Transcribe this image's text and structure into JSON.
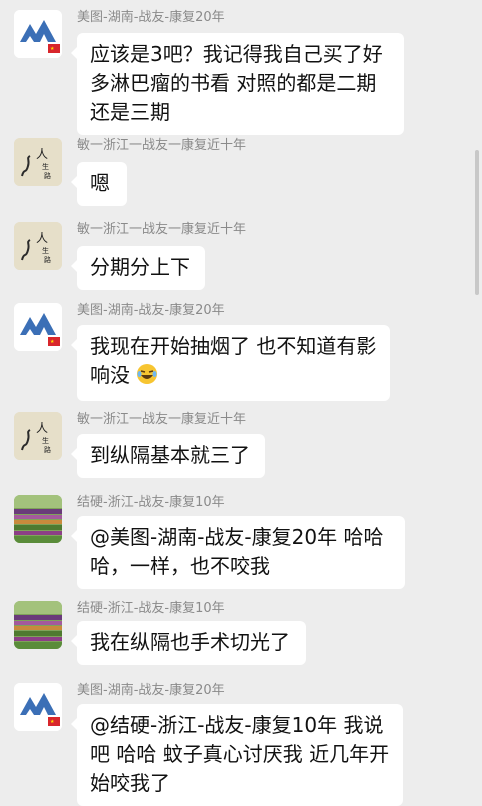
{
  "messages": [
    {
      "sender": "美图-湖南-战友-康复20年",
      "avatar": "mountain-flag-avatar",
      "lines": [
        "应该是3吧？我记得我自己买了好",
        "多淋巴瘤的书看 对照的都是二期",
        "还是三期"
      ]
    },
    {
      "sender": "敏一浙江一战友一康复近十年",
      "avatar": "calligraphy-avatar",
      "lines": [
        "嗯"
      ]
    },
    {
      "sender": "敏一浙江一战友一康复近十年",
      "avatar": "calligraphy-avatar",
      "lines": [
        "分期分上下"
      ]
    },
    {
      "sender": "美图-湖南-战友-康复20年",
      "avatar": "mountain-flag-avatar",
      "lines": [
        "我现在开始抽烟了 也不知道有影",
        "响没"
      ],
      "emoji": "laughing-crying-emoji"
    },
    {
      "sender": "敏一浙江一战友一康复近十年",
      "avatar": "calligraphy-avatar",
      "lines": [
        "到纵隔基本就三了"
      ]
    },
    {
      "sender": "结硬-浙江-战友-康复10年",
      "avatar": "field-avatar",
      "lines": [
        "@美图-湖南-战友-康复20年 哈哈",
        "哈，一样，也不咬我"
      ]
    },
    {
      "sender": "结硬-浙江-战友-康复10年",
      "avatar": "field-avatar",
      "lines": [
        "我在纵隔也手术切光了"
      ]
    },
    {
      "sender": "美图-湖南-战友-康复20年",
      "avatar": "mountain-flag-avatar",
      "lines": [
        "@结硬-浙江-战友-康复10年 我说",
        "吧 哈哈 蚊子真心讨厌我 近几年开",
        "始咬我了"
      ]
    }
  ],
  "avatar_text": {
    "calligraphy_top": "人",
    "calligraphy_mid": "生",
    "calligraphy_bot": "路"
  },
  "colors": {
    "background": "#ededed",
    "bubble": "#ffffff",
    "name": "#8a8a8a",
    "mountain": "#3b6fb6",
    "flag": "#d8262c"
  }
}
